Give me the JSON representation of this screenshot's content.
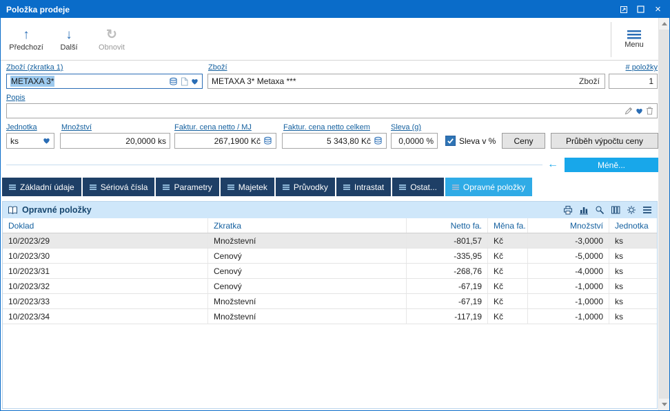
{
  "window": {
    "title": "Položka prodeje"
  },
  "toolbar": {
    "prev": "Předchozí",
    "next": "Další",
    "refresh": "Obnovit",
    "menu": "Menu"
  },
  "form": {
    "item_code": {
      "label": "Zboží (zkratka 1)",
      "value": "METAXA 3*"
    },
    "item": {
      "label": "Zboží",
      "value": "METAXA 3* Metaxa ***",
      "inline_button": "Zboží"
    },
    "item_count": {
      "label": "# položky",
      "value": "1"
    },
    "description": {
      "label": "Popis",
      "value": ""
    },
    "unit": {
      "label": "Jednotka",
      "value": "ks"
    },
    "quantity": {
      "label": "Množství",
      "value": "20,0000 ks"
    },
    "unit_price": {
      "label": "Faktur. cena netto / MJ",
      "value": "267,1900 Kč"
    },
    "total_price": {
      "label": "Faktur. cena netto celkem",
      "value": "5 343,80 Kč"
    },
    "discount": {
      "label": "Sleva (g)",
      "value": "0,0000 %"
    },
    "discount_percent_checkbox": {
      "label": "Sleva v %",
      "checked": true
    },
    "prices_button": "Ceny",
    "price_calc_button": "Průběh výpočtu ceny",
    "less_button": "Méně..."
  },
  "tabs": [
    {
      "label": "Základní údaje",
      "active": false
    },
    {
      "label": "Sériová čísla",
      "active": false
    },
    {
      "label": "Parametry",
      "active": false
    },
    {
      "label": "Majetek",
      "active": false
    },
    {
      "label": "Průvodky",
      "active": false
    },
    {
      "label": "Intrastat",
      "active": false
    },
    {
      "label": "Ostat...",
      "active": false
    },
    {
      "label": "Opravné položky",
      "active": true
    }
  ],
  "panel": {
    "title": "Opravné položky"
  },
  "table": {
    "columns": [
      {
        "label": "Doklad",
        "align": "left"
      },
      {
        "label": "Zkratka",
        "align": "left"
      },
      {
        "label": "Netto fa.",
        "align": "right"
      },
      {
        "label": "Měna fa.",
        "align": "left"
      },
      {
        "label": "Množství",
        "align": "right"
      },
      {
        "label": "Jednotka",
        "align": "left"
      }
    ],
    "rows": [
      [
        "10/2023/29",
        "Množstevní",
        "-801,57",
        "Kč",
        "-3,0000",
        "ks"
      ],
      [
        "10/2023/30",
        "Cenový",
        "-335,95",
        "Kč",
        "-5,0000",
        "ks"
      ],
      [
        "10/2023/31",
        "Cenový",
        "-268,76",
        "Kč",
        "-4,0000",
        "ks"
      ],
      [
        "10/2023/32",
        "Cenový",
        "-67,19",
        "Kč",
        "-1,0000",
        "ks"
      ],
      [
        "10/2023/33",
        "Množstevní",
        "-67,19",
        "Kč",
        "-1,0000",
        "ks"
      ],
      [
        "10/2023/34",
        "Množstevní",
        "-117,19",
        "Kč",
        "-1,0000",
        "ks"
      ]
    ],
    "selected_row_index": 0
  },
  "icons": {
    "titlebar": [
      "float-window",
      "maximize",
      "close"
    ],
    "toolbar": [
      "arrow-up",
      "arrow-down",
      "refresh",
      "hamburger-menu"
    ],
    "item_code_field": [
      "coins",
      "document",
      "favorites-heart"
    ],
    "description_field": [
      "pencil",
      "favorites-heart",
      "trash"
    ],
    "panel_header": [
      "book",
      "print",
      "chart",
      "search",
      "columns",
      "settings-gear",
      "hamburger-menu"
    ]
  },
  "colors": {
    "titlebar": "#0a6cc9",
    "accent": "#2a6db5",
    "label": "#14609f",
    "tab": "#1e3f66",
    "tab_active": "#2fabe6",
    "less_button": "#18a7ea",
    "panel_header_bg": "#cfe7fa",
    "panel_header_text": "#17466e",
    "selection": "#9cc9ee",
    "selected_row": "#e9e9e9"
  }
}
